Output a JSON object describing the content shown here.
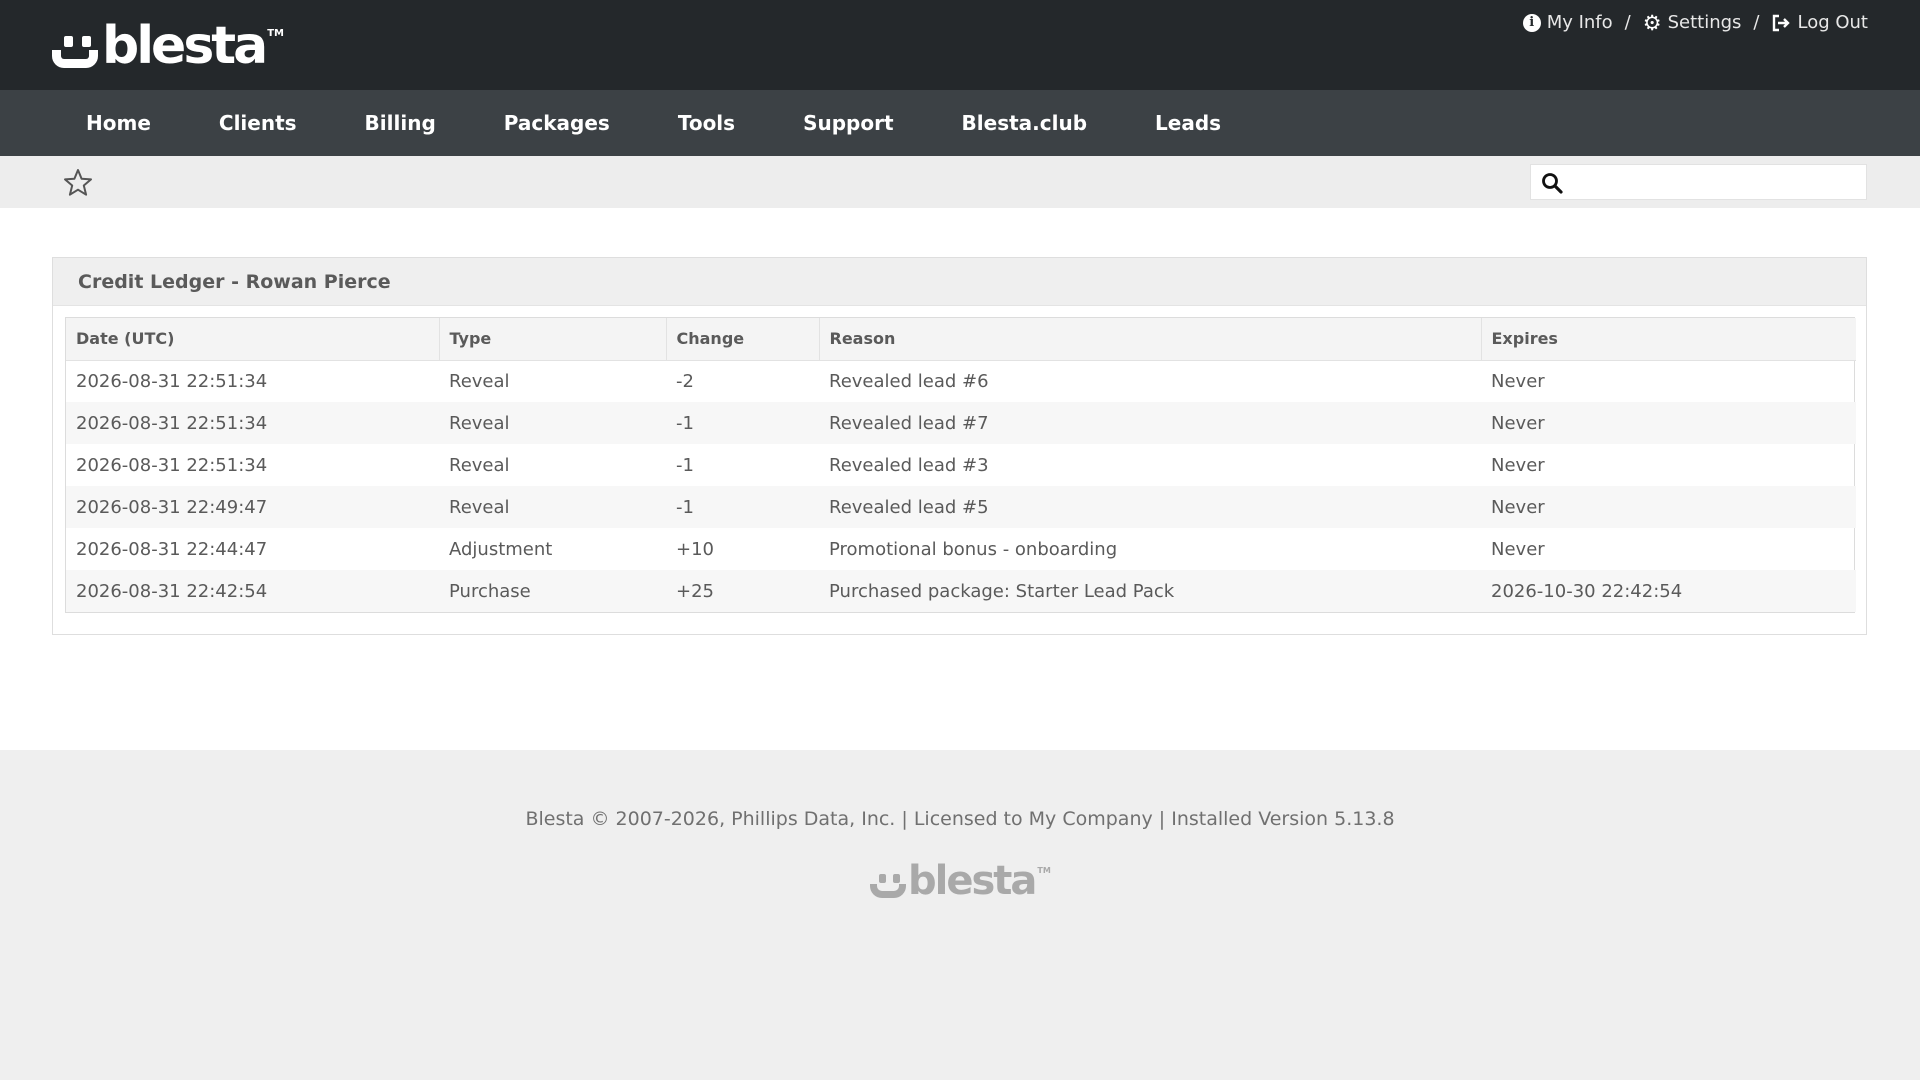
{
  "brand": {
    "logo_text": "blesta",
    "logo_tm": "TM"
  },
  "user_links": [
    {
      "label": "My Info",
      "icon": "info-circle-icon"
    },
    {
      "label": "Settings",
      "icon": "gear-icon"
    },
    {
      "label": "Log Out",
      "icon": "sign-out-icon"
    }
  ],
  "separator": "/",
  "nav": [
    "Home",
    "Clients",
    "Billing",
    "Packages",
    "Tools",
    "Support",
    "Blesta.club",
    "Leads"
  ],
  "search": {
    "placeholder": "",
    "value": ""
  },
  "panel": {
    "title": "Credit Ledger - Rowan Pierce",
    "columns": [
      "Date (UTC)",
      "Type",
      "Change",
      "Reason",
      "Expires"
    ],
    "rows": [
      [
        "2026-08-31 22:51:34",
        "Reveal",
        "-2",
        "Revealed lead #6",
        "Never"
      ],
      [
        "2026-08-31 22:51:34",
        "Reveal",
        "-1",
        "Revealed lead #7",
        "Never"
      ],
      [
        "2026-08-31 22:51:34",
        "Reveal",
        "-1",
        "Revealed lead #3",
        "Never"
      ],
      [
        "2026-08-31 22:49:47",
        "Reveal",
        "-1",
        "Revealed lead #5",
        "Never"
      ],
      [
        "2026-08-31 22:44:47",
        "Adjustment",
        "+10",
        "Promotional bonus - onboarding",
        "Never"
      ],
      [
        "2026-08-31 22:42:54",
        "Purchase",
        "+25",
        "Purchased package: Starter Lead Pack",
        "2026-10-30 22:42:54"
      ]
    ]
  },
  "footer": {
    "text": "Blesta © 2007-2026, Phillips Data, Inc. | Licensed to My Company | Installed Version 5.13.8",
    "logo_text": "blesta",
    "logo_tm": "TM"
  },
  "colors": {
    "header_bg": "#24282b",
    "nav_bg": "#3c4145",
    "subbar_bg": "#ededed",
    "footer_bg": "#efefef"
  }
}
